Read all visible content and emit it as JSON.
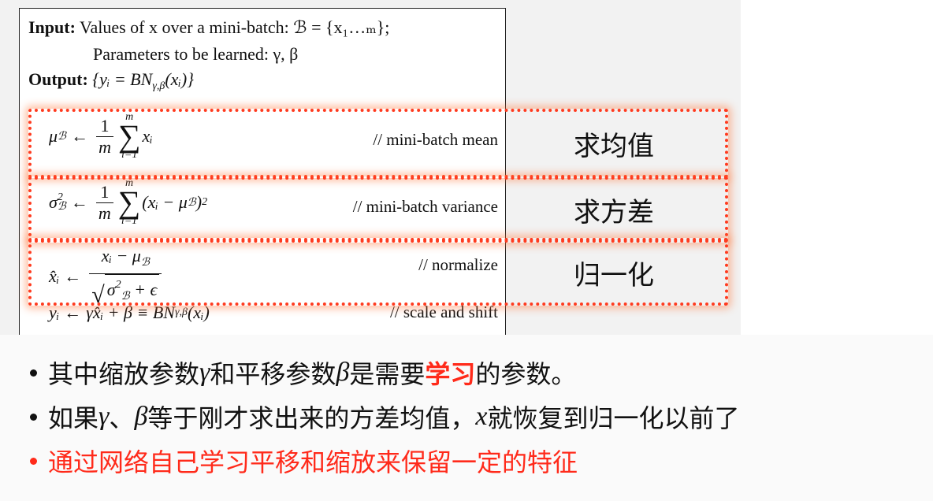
{
  "algorithm": {
    "input_label": "Input:",
    "input_text": "Values of x over a mini-batch: ℬ = {x₁…ₘ};",
    "params_text": "Parameters to be learned: γ, β",
    "output_label": "Output:",
    "output_text": "{yᵢ = BN",
    "output_sub": "γ,β",
    "output_tail": "(xᵢ)}",
    "steps": [
      {
        "lhs": "μ",
        "lhs_sub": "ℬ",
        "arrow": "←",
        "num": "1",
        "den": "m",
        "sum_top": "m",
        "sum_bot": "i=1",
        "body": "xᵢ",
        "comment": "// mini-batch mean",
        "cn_label": "求均值"
      },
      {
        "lhs": "σ",
        "lhs_sub": "ℬ",
        "lhs_sup": "2",
        "arrow": "←",
        "num": "1",
        "den": "m",
        "sum_top": "m",
        "sum_bot": "i=1",
        "body": "(xᵢ − μ",
        "body_sub": "ℬ",
        "body_tail": ")",
        "body_sup": "2",
        "comment": "// mini-batch variance",
        "cn_label": "求方差"
      },
      {
        "lhs": "x̂ᵢ",
        "arrow": "←",
        "num": "xᵢ − μ",
        "num_sub": "ℬ",
        "den_a": "σ",
        "den_sub": "ℬ",
        "den_sup": "2",
        "den_b": " + ϵ",
        "comment": "// normalize",
        "cn_label": "归一化"
      },
      {
        "lhs": "yᵢ",
        "arrow": "←",
        "body": "γx̂ᵢ + β ≡ BN",
        "body_sub": "γ,β",
        "body_tail": "(xᵢ)",
        "comment": "// scale and shift"
      }
    ]
  },
  "notes": [
    {
      "pre": "其中缩放参数",
      "var1": "γ",
      "mid": "和平移参数",
      "var2": "β",
      "post": "是需要",
      "highlight": "学习",
      "tail": "的参数。"
    },
    {
      "pre": "如果",
      "var1": "γ",
      "mid": "、",
      "var2": "β",
      "post": "等于刚才求出来的方差均值，",
      "var3": "x",
      "tail": "就恢复到归一化以前了"
    },
    {
      "text": "通过网络自己学习平移和缩放来保留一定的特征"
    }
  ],
  "colors": {
    "highlight_red": "#ff2a1a",
    "box_dotted": "#ff3b1f"
  }
}
